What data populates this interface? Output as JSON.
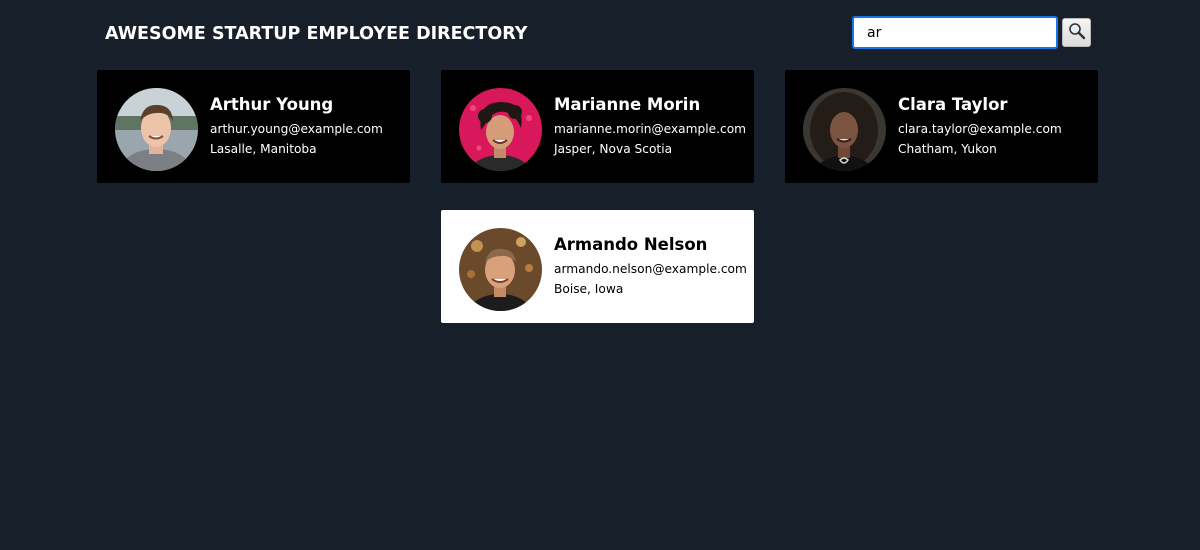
{
  "header": {
    "title": "AWESOME STARTUP EMPLOYEE DIRECTORY"
  },
  "search": {
    "value": "ar",
    "button_icon": "magnifier-icon"
  },
  "employees": [
    {
      "name": "Arthur Young",
      "email": "arthur.young@example.com",
      "location": "Lasalle, Manitoba",
      "avatar_icon": "avatar-photo",
      "active": false
    },
    {
      "name": "Marianne Morin",
      "email": "marianne.morin@example.com",
      "location": "Jasper, Nova Scotia",
      "avatar_icon": "avatar-photo",
      "active": false
    },
    {
      "name": "Clara Taylor",
      "email": "clara.taylor@example.com",
      "location": "Chatham, Yukon",
      "avatar_icon": "avatar-photo",
      "active": false
    },
    {
      "name": "Armando Nelson",
      "email": "armando.nelson@example.com",
      "location": "Boise, Iowa",
      "avatar_icon": "avatar-photo",
      "active": true
    }
  ],
  "colors": {
    "page_background": "#17202a",
    "card_background": "#000000",
    "card_active_background": "#ffffff",
    "search_border": "#1a73e8"
  }
}
